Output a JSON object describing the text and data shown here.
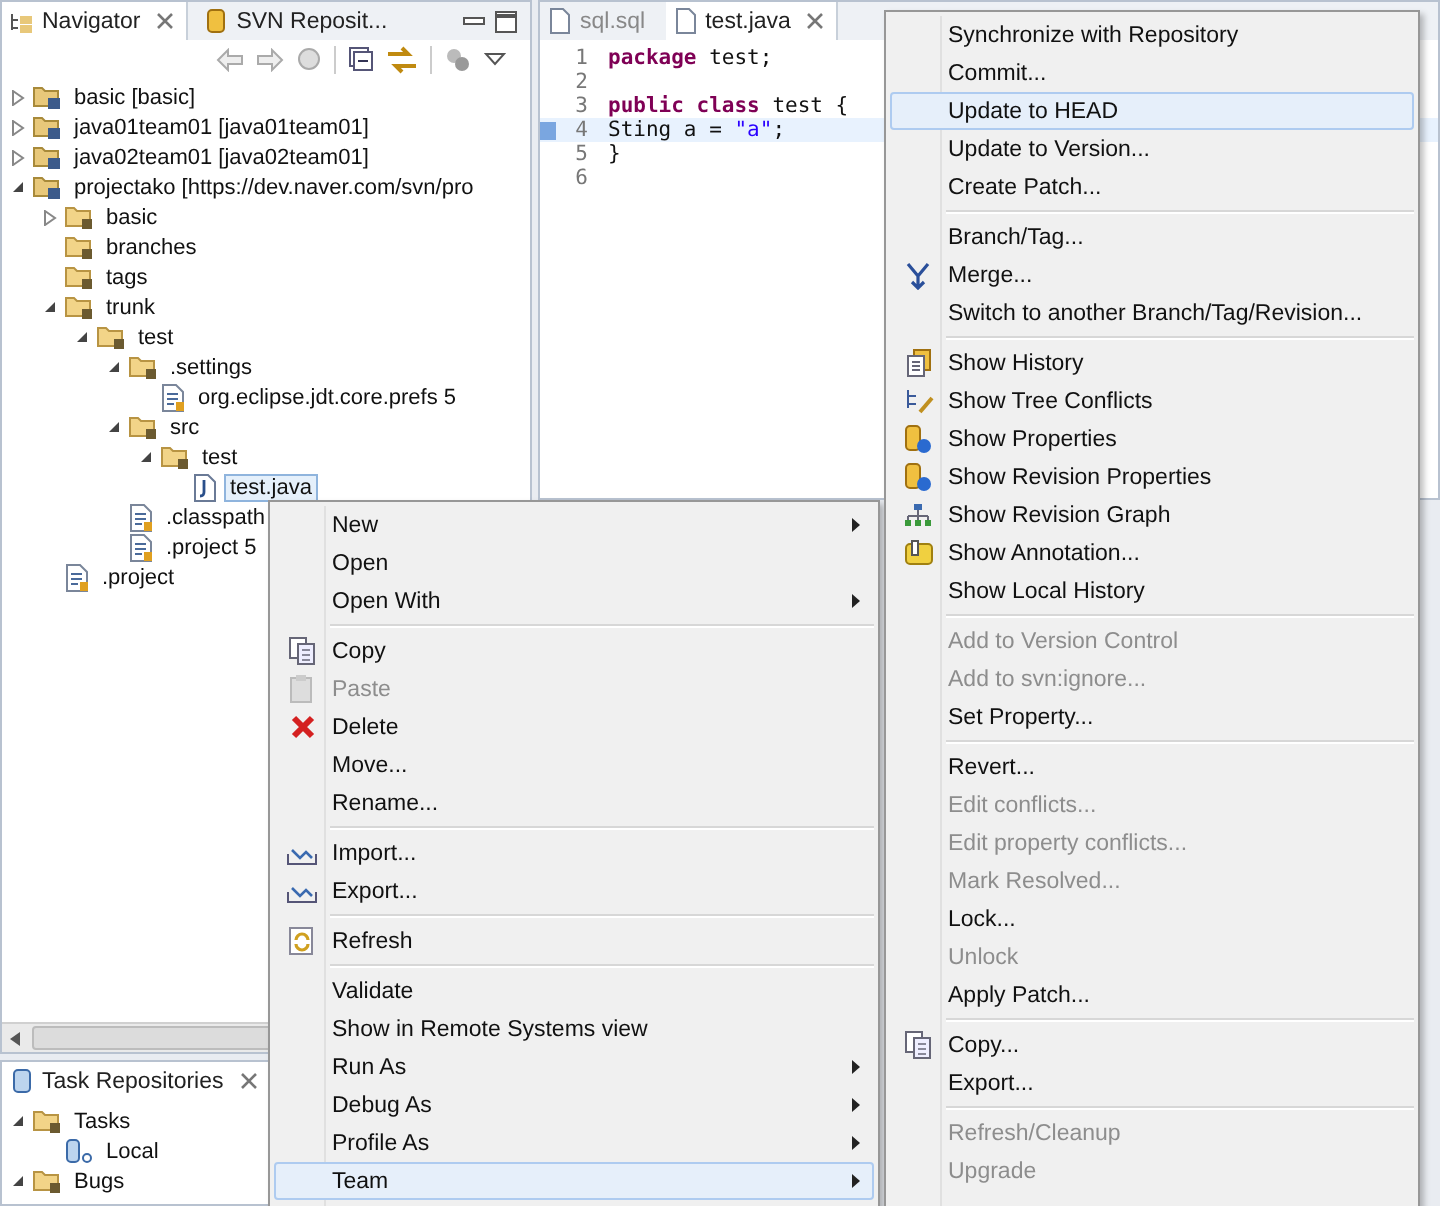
{
  "navigator": {
    "tabs": [
      {
        "label": "Navigator",
        "selected": true,
        "closable": true
      },
      {
        "label": "SVN Reposit...",
        "selected": false,
        "closable": false
      }
    ],
    "tree": [
      {
        "label": "basic [basic]",
        "kind": "project",
        "expanded": false,
        "selected": false
      },
      {
        "label": "java01team01 [java01team01]",
        "kind": "project",
        "expanded": false,
        "selected": false
      },
      {
        "label": "java02team01 [java02team01]",
        "kind": "project",
        "expanded": false,
        "selected": false
      },
      {
        "label": "projectako [https://dev.naver.com/svn/pro",
        "kind": "project",
        "expanded": true,
        "selected": false,
        "children": [
          {
            "label": "basic",
            "kind": "folder",
            "expanded": false,
            "selected": false
          },
          {
            "label": "branches",
            "kind": "folder",
            "selected": false
          },
          {
            "label": "tags",
            "kind": "folder",
            "selected": false
          },
          {
            "label": "trunk",
            "kind": "folder",
            "expanded": true,
            "selected": false,
            "children": [
              {
                "label": "test",
                "kind": "folder",
                "expanded": true,
                "selected": false,
                "children": [
                  {
                    "label": ".settings",
                    "kind": "folder",
                    "expanded": true,
                    "selected": false,
                    "children": [
                      {
                        "label": "org.eclipse.jdt.core.prefs 5",
                        "kind": "file",
                        "selected": false
                      }
                    ]
                  },
                  {
                    "label": "src",
                    "kind": "folder",
                    "expanded": true,
                    "selected": false,
                    "children": [
                      {
                        "label": "test",
                        "kind": "folder",
                        "expanded": true,
                        "selected": false,
                        "children": [
                          {
                            "label": "test.java",
                            "kind": "java",
                            "selected": true
                          }
                        ]
                      }
                    ]
                  },
                  {
                    "label": ".classpath",
                    "kind": "file",
                    "selected": false
                  },
                  {
                    "label": ".project 5",
                    "kind": "file",
                    "selected": false
                  }
                ]
              }
            ]
          },
          {
            "label": ".project",
            "kind": "file",
            "selected": false
          }
        ]
      }
    ]
  },
  "editor": {
    "tabs": [
      {
        "label": "sql.sql",
        "selected": false,
        "closable": false
      },
      {
        "label": "test.java",
        "selected": true,
        "closable": true
      }
    ],
    "lines": [
      {
        "number": "1",
        "current": false,
        "tokens": [
          {
            "kind": "keyword",
            "text": "package"
          },
          {
            "kind": "plain",
            "text": " test;"
          }
        ]
      },
      {
        "number": "2",
        "current": false
      },
      {
        "number": "3",
        "current": false,
        "tokens": [
          {
            "kind": "keyword",
            "text": "public"
          },
          {
            "kind": "keyword",
            "text": " class"
          },
          {
            "kind": "plain",
            "text": " test {"
          }
        ]
      },
      {
        "number": "4",
        "current": true,
        "tokens": [
          {
            "kind": "plain",
            "text": "Sting a = "
          },
          {
            "kind": "string",
            "text": "\"a\""
          },
          {
            "kind": "plain",
            "text": ";"
          }
        ]
      },
      {
        "number": "5",
        "current": false,
        "tokens": [
          {
            "kind": "plain",
            "text": "}"
          }
        ]
      },
      {
        "number": "6",
        "current": false
      }
    ]
  },
  "task_repositories": {
    "tab": {
      "label": "Task Repositories",
      "selected": true,
      "closable": true
    },
    "tree": [
      {
        "label": "Tasks",
        "kind": "folder",
        "expanded": true,
        "selected": false,
        "children": [
          {
            "label": "Local",
            "kind": "repository",
            "selected": false
          }
        ]
      },
      {
        "label": "Bugs",
        "kind": "folder",
        "expanded": true,
        "selected": false
      }
    ]
  },
  "context_menu": {
    "groups": [
      [
        {
          "label": "New",
          "kind": "plain",
          "submenu": true,
          "disabled": false,
          "selected": false
        },
        {
          "label": "Open",
          "kind": "plain",
          "submenu": false,
          "disabled": false,
          "selected": false
        },
        {
          "label": "Open With",
          "kind": "plain",
          "submenu": true,
          "disabled": false,
          "selected": false
        }
      ],
      [
        {
          "label": "Copy",
          "kind": "copy",
          "submenu": false,
          "disabled": false,
          "selected": false
        },
        {
          "label": "Paste",
          "kind": "paste",
          "submenu": false,
          "disabled": true,
          "selected": false
        },
        {
          "label": "Delete",
          "kind": "delete",
          "submenu": false,
          "disabled": false,
          "selected": false
        },
        {
          "label": "Move...",
          "kind": "plain",
          "submenu": false,
          "disabled": false,
          "selected": false
        },
        {
          "label": "Rename...",
          "kind": "plain",
          "submenu": false,
          "disabled": false,
          "selected": false
        }
      ],
      [
        {
          "label": "Import...",
          "kind": "import",
          "submenu": false,
          "disabled": false,
          "selected": false
        },
        {
          "label": "Export...",
          "kind": "export",
          "submenu": false,
          "disabled": false,
          "selected": false
        }
      ],
      [
        {
          "label": "Refresh",
          "kind": "refresh",
          "submenu": false,
          "disabled": false,
          "selected": false
        }
      ],
      [
        {
          "label": "Validate",
          "kind": "plain",
          "submenu": false,
          "disabled": false,
          "selected": false
        },
        {
          "label": "Show in Remote Systems view",
          "kind": "plain",
          "submenu": false,
          "disabled": false,
          "selected": false
        },
        {
          "label": "Run As",
          "kind": "plain",
          "submenu": true,
          "disabled": false,
          "selected": false
        },
        {
          "label": "Debug As",
          "kind": "plain",
          "submenu": true,
          "disabled": false,
          "selected": false
        },
        {
          "label": "Profile As",
          "kind": "plain",
          "submenu": true,
          "disabled": false,
          "selected": false
        },
        {
          "label": "Team",
          "kind": "plain",
          "submenu": true,
          "disabled": false,
          "selected": true
        }
      ]
    ]
  },
  "team_menu": {
    "groups": [
      [
        {
          "label": "Synchronize with Repository",
          "kind": "plain",
          "disabled": false,
          "selected": false
        },
        {
          "label": "Commit...",
          "kind": "plain",
          "disabled": false,
          "selected": false
        },
        {
          "label": "Update to HEAD",
          "kind": "plain",
          "disabled": false,
          "selected": true
        },
        {
          "label": "Update to Version...",
          "kind": "plain",
          "disabled": false,
          "selected": false
        },
        {
          "label": "Create Patch...",
          "kind": "plain",
          "disabled": false,
          "selected": false
        }
      ],
      [
        {
          "label": "Branch/Tag...",
          "kind": "plain",
          "disabled": false,
          "selected": false
        },
        {
          "label": "Merge...",
          "kind": "merge",
          "disabled": false,
          "selected": false
        },
        {
          "label": "Switch to another Branch/Tag/Revision...",
          "kind": "plain",
          "disabled": false,
          "selected": false
        }
      ],
      [
        {
          "label": "Show History",
          "kind": "history",
          "disabled": false,
          "selected": false
        },
        {
          "label": "Show Tree Conflicts",
          "kind": "conflicts",
          "disabled": false,
          "selected": false
        },
        {
          "label": "Show Properties",
          "kind": "properties",
          "disabled": false,
          "selected": false
        },
        {
          "label": "Show Revision Properties",
          "kind": "properties",
          "disabled": false,
          "selected": false
        },
        {
          "label": "Show Revision Graph",
          "kind": "graph",
          "disabled": false,
          "selected": false
        },
        {
          "label": "Show Annotation...",
          "kind": "annotation",
          "disabled": false,
          "selected": false
        },
        {
          "label": "Show Local History",
          "kind": "plain",
          "disabled": false,
          "selected": false
        }
      ],
      [
        {
          "label": "Add to Version Control",
          "kind": "plain",
          "disabled": true,
          "selected": false
        },
        {
          "label": "Add to svn:ignore...",
          "kind": "plain",
          "disabled": true,
          "selected": false
        },
        {
          "label": "Set Property...",
          "kind": "plain",
          "disabled": false,
          "selected": false
        }
      ],
      [
        {
          "label": "Revert...",
          "kind": "plain",
          "disabled": false,
          "selected": false
        },
        {
          "label": "Edit conflicts...",
          "kind": "plain",
          "disabled": true,
          "selected": false
        },
        {
          "label": "Edit property conflicts...",
          "kind": "plain",
          "disabled": true,
          "selected": false
        },
        {
          "label": "Mark Resolved...",
          "kind": "plain",
          "disabled": true,
          "selected": false
        },
        {
          "label": "Lock...",
          "kind": "plain",
          "disabled": false,
          "selected": false
        },
        {
          "label": "Unlock",
          "kind": "plain",
          "disabled": true,
          "selected": false
        },
        {
          "label": "Apply Patch...",
          "kind": "plain",
          "disabled": false,
          "selected": false
        }
      ],
      [
        {
          "label": "Copy...",
          "kind": "copy",
          "disabled": false,
          "selected": false
        },
        {
          "label": "Export...",
          "kind": "plain",
          "disabled": false,
          "selected": false
        }
      ],
      [
        {
          "label": "Refresh/Cleanup",
          "kind": "plain",
          "disabled": true,
          "selected": false
        },
        {
          "label": "Upgrade",
          "kind": "plain",
          "disabled": true,
          "selected": false
        }
      ]
    ]
  }
}
